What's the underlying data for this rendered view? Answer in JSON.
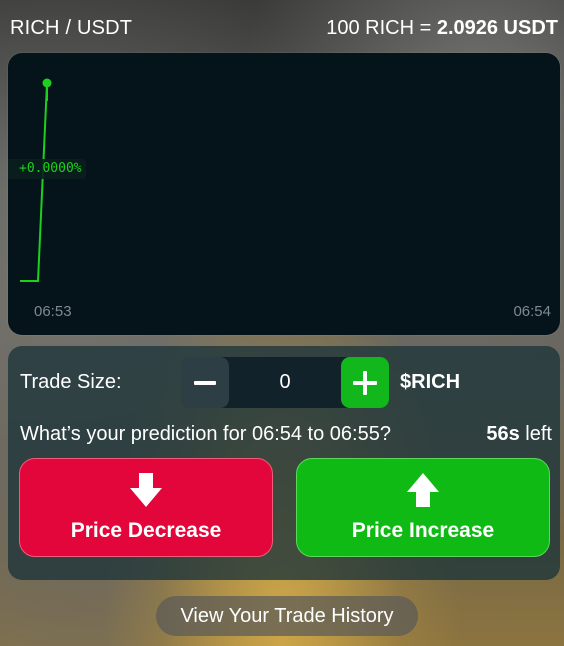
{
  "header": {
    "pair": "RICH / USDT",
    "rate_prefix": "100 RICH = ",
    "rate_value": "2.0926 USDT"
  },
  "chart": {
    "change_label": "+0.0000%",
    "tick_start": "06:53",
    "tick_end": "06:54",
    "line_color": "#1ed01e",
    "background_color": "#05141b"
  },
  "chart_data": {
    "type": "line",
    "x_ticks": [
      "06:53",
      "06:54"
    ],
    "series": [
      {
        "values": [
          0.0,
          0.0,
          1.0
        ]
      }
    ],
    "annotation": "+0.0000%"
  },
  "trade": {
    "size_label": "Trade Size:",
    "quantity": "0",
    "minus_icon": "minus-icon",
    "plus_icon": "plus-icon",
    "token": "$RICH",
    "question": "What’s your prediction for 06:54 to 06:55?",
    "seconds": "56s",
    "seconds_suffix": " left",
    "decrease_label": "Price Decrease",
    "increase_label": "Price Increase",
    "decrease_color": "#e2063b",
    "increase_color": "#10ba14"
  },
  "footer": {
    "history_label": "View Your Trade History"
  }
}
